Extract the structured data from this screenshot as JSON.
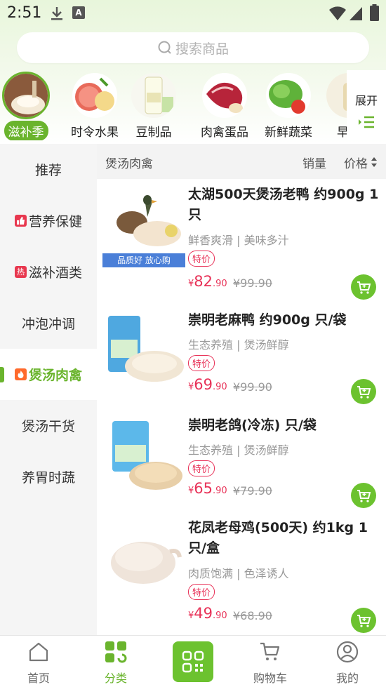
{
  "status": {
    "time": "2:51",
    "a_label": "A"
  },
  "search": {
    "placeholder": "搜索商品"
  },
  "categories": [
    {
      "label": "滋补季",
      "active": true
    },
    {
      "label": "时令水果"
    },
    {
      "label": "豆制品"
    },
    {
      "label": "肉禽蛋品"
    },
    {
      "label": "新鲜蔬菜"
    },
    {
      "label": "早餐"
    }
  ],
  "expand_label": "展开",
  "sidebar": {
    "items": [
      {
        "label": "推荐"
      },
      {
        "label": "营养保健",
        "badge": "👍"
      },
      {
        "label": "滋补酒类",
        "badge": "热"
      },
      {
        "label": "冲泡冲调"
      },
      {
        "label": "煲汤肉禽",
        "active": true,
        "badge": "🔥"
      },
      {
        "label": "煲汤干货"
      },
      {
        "label": "养胃时蔬"
      }
    ]
  },
  "list_header": {
    "category": "煲汤肉禽",
    "sales": "销量",
    "price": "价格"
  },
  "products": [
    {
      "title": "太湖500天煲汤老鸭 约900g 1只",
      "subtitle": "鲜香爽滑 | 美味多汁",
      "tag": "特价",
      "currency": "¥",
      "price_int": "82",
      "price_dec": ".90",
      "old_price": "¥99.90",
      "quality_banner": "品质好 放心购"
    },
    {
      "title": "崇明老麻鸭 约900g 只/袋",
      "subtitle": "生态养殖 | 煲汤鲜醇",
      "tag": "特价",
      "currency": "¥",
      "price_int": "69",
      "price_dec": ".90",
      "old_price": "¥99.90"
    },
    {
      "title": "崇明老鸽(冷冻) 只/袋",
      "subtitle": "生态养殖 | 煲汤鲜醇",
      "tag": "特价",
      "currency": "¥",
      "price_int": "65",
      "price_dec": ".90",
      "old_price": "¥79.90"
    },
    {
      "title": "花凤老母鸡(500天) 约1kg 1只/盒",
      "subtitle": "肉质饱满 | 色泽诱人",
      "tag": "特价",
      "currency": "¥",
      "price_int": "49",
      "price_dec": ".90",
      "old_price": "¥68.90"
    }
  ],
  "nav": {
    "home": "首页",
    "category": "分类",
    "cart": "购物车",
    "mine": "我的"
  },
  "colors": {
    "accent": "#6ab42d",
    "price": "#e83258"
  }
}
